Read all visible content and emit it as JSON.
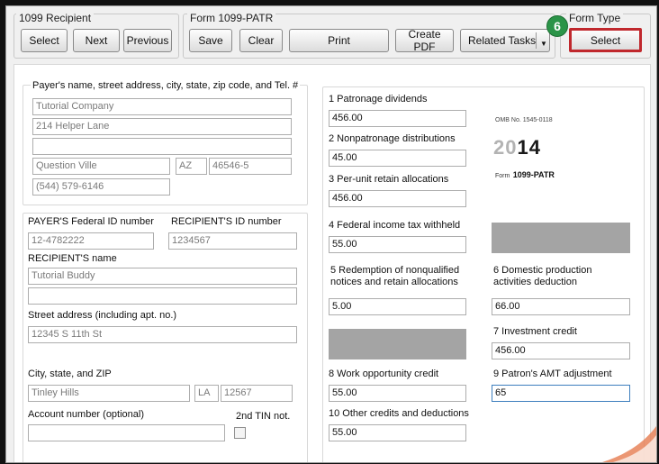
{
  "recipient_group": {
    "title": "1099 Recipient",
    "select": "Select",
    "next": "Next",
    "previous": "Previous"
  },
  "form_group": {
    "title": "Form 1099-PATR",
    "save": "Save",
    "clear": "Clear",
    "print": "Print",
    "create_pdf": "Create PDF",
    "related_tasks": "Related Tasks"
  },
  "form_type_group": {
    "title": "Form Type",
    "select": "Select",
    "step_badge": "6"
  },
  "payer": {
    "label": "Payer's name, street address, city, state, zip code, and Tel. #",
    "name": "Tutorial Company",
    "street": "214 Helper Lane",
    "extra": "",
    "city": "Question Ville",
    "state": "AZ",
    "zip": "46546-5",
    "phone": "(544) 579-6146"
  },
  "recipient": {
    "payer_id_label": "PAYER'S Federal ID number",
    "payer_id": "12-4782222",
    "recipient_id_label": "RECIPIENT'S ID number",
    "recipient_id": "1234567",
    "name_label": "RECIPIENT'S name",
    "name": "Tutorial Buddy",
    "name2": "",
    "street_label": "Street address (including apt. no.)",
    "street": "12345 S 11th St",
    "csz_label": "City, state, and ZIP",
    "city": "Tinley Hills",
    "state": "LA",
    "zip": "12567",
    "account_label": "Account number (optional)",
    "account": "",
    "tin_label": "2nd TIN not."
  },
  "boxes": {
    "b1_label": "1 Patronage dividends",
    "b1": "456.00",
    "b2_label": "2 Nonpatronage distributions",
    "b2": "45.00",
    "b3_label": "3 Per-unit retain allocations",
    "b3": "456.00",
    "b4_label": "4 Federal income tax withheld",
    "b4": "55.00",
    "b5_label_1": "5 Redemption of nonqualified",
    "b5_label_2": "notices and retain allocations",
    "b5": "5.00",
    "b6_label_1": "6 Domestic production",
    "b6_label_2": "activities deduction",
    "b6": "66.00",
    "b7_label": "7 Investment credit",
    "b7": "456.00",
    "b8_label": "8 Work opportunity credit",
    "b8": "55.00",
    "b9_label": "9 Patron's AMT adjustment",
    "b9": "65",
    "b10_label": "10 Other credits and deductions",
    "b10": "55.00"
  },
  "omb": {
    "text": "OMB No. 1545-0118",
    "year_light": "20",
    "year_bold": "14",
    "form_prefix": "Form",
    "form_name": "1099-PATR"
  }
}
